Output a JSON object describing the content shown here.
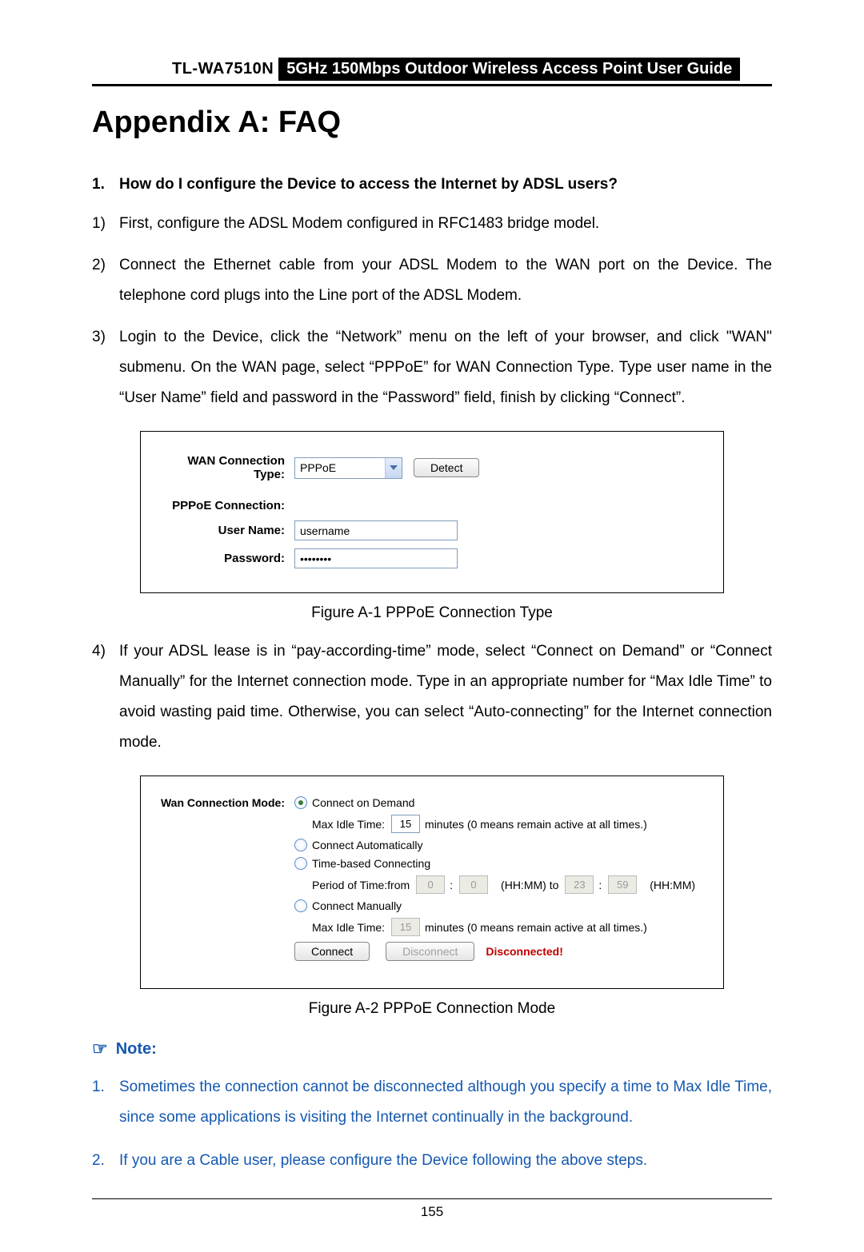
{
  "header": {
    "model": "TL-WA7510N",
    "title": "5GHz 150Mbps Outdoor Wireless Access Point User Guide"
  },
  "page_title": "Appendix A: FAQ",
  "q1": {
    "num": "1.",
    "text": "How do I configure the Device to access the Internet by ADSL users?"
  },
  "steps": {
    "s1": {
      "num": "1)",
      "text": "First, configure the ADSL Modem configured in RFC1483 bridge model."
    },
    "s2": {
      "num": "2)",
      "text": "Connect the Ethernet cable from your ADSL Modem to the WAN port on the Device. The telephone cord plugs into the Line port of the ADSL Modem."
    },
    "s3": {
      "num": "3)",
      "text": "Login to the Device, click the “Network” menu on the left of your browser, and click \"WAN\" submenu. On the WAN page, select “PPPoE” for WAN Connection Type. Type user name in the “User Name” field and password in the “Password” field, finish by clicking “Connect”."
    },
    "s4": {
      "num": "4)",
      "text": "If your ADSL lease is in “pay-according-time” mode, select “Connect on Demand” or “Connect Manually” for the Internet connection mode. Type in an appropriate number for “Max Idle Time” to avoid wasting paid time. Otherwise, you can select “Auto-connecting” for the Internet connection mode."
    }
  },
  "fig1": {
    "conn_type_label": "WAN Connection Type:",
    "conn_type_value": "PPPoE",
    "detect_btn": "Detect",
    "section": "PPPoE Connection:",
    "user_label": "User Name:",
    "user_value": "username",
    "pass_label": "Password:",
    "pass_value": "••••••••",
    "caption": "Figure A-1 PPPoE Connection Type"
  },
  "fig2": {
    "mode_label": "Wan Connection Mode:",
    "opt_demand": "Connect on Demand",
    "max_idle_label": "Max Idle Time:",
    "max_idle_val_1": "15",
    "max_idle_suffix": "minutes (0 means remain active at all times.)",
    "opt_auto": "Connect Automatically",
    "opt_time": "Time-based Connecting",
    "period_label": "Period of Time:from",
    "t_from_h": "0",
    "t_from_m": "0",
    "hhmm_to": "(HH:MM) to",
    "t_to_h": "23",
    "t_to_m": "59",
    "hhmm": "(HH:MM)",
    "opt_manual": "Connect Manually",
    "max_idle_val_2": "15",
    "btn_connect": "Connect",
    "btn_disconnect": "Disconnect",
    "status": "Disconnected!",
    "caption": "Figure A-2 PPPoE Connection Mode",
    "colon": ":"
  },
  "note": {
    "heading": "Note:",
    "n1": {
      "num": "1.",
      "text": "Sometimes the connection cannot be disconnected although you specify a time to Max Idle Time, since some applications is visiting the Internet continually in the background."
    },
    "n2": {
      "num": "2.",
      "text": "If you are a Cable user, please configure the Device following the above steps."
    }
  },
  "page_num": "155"
}
